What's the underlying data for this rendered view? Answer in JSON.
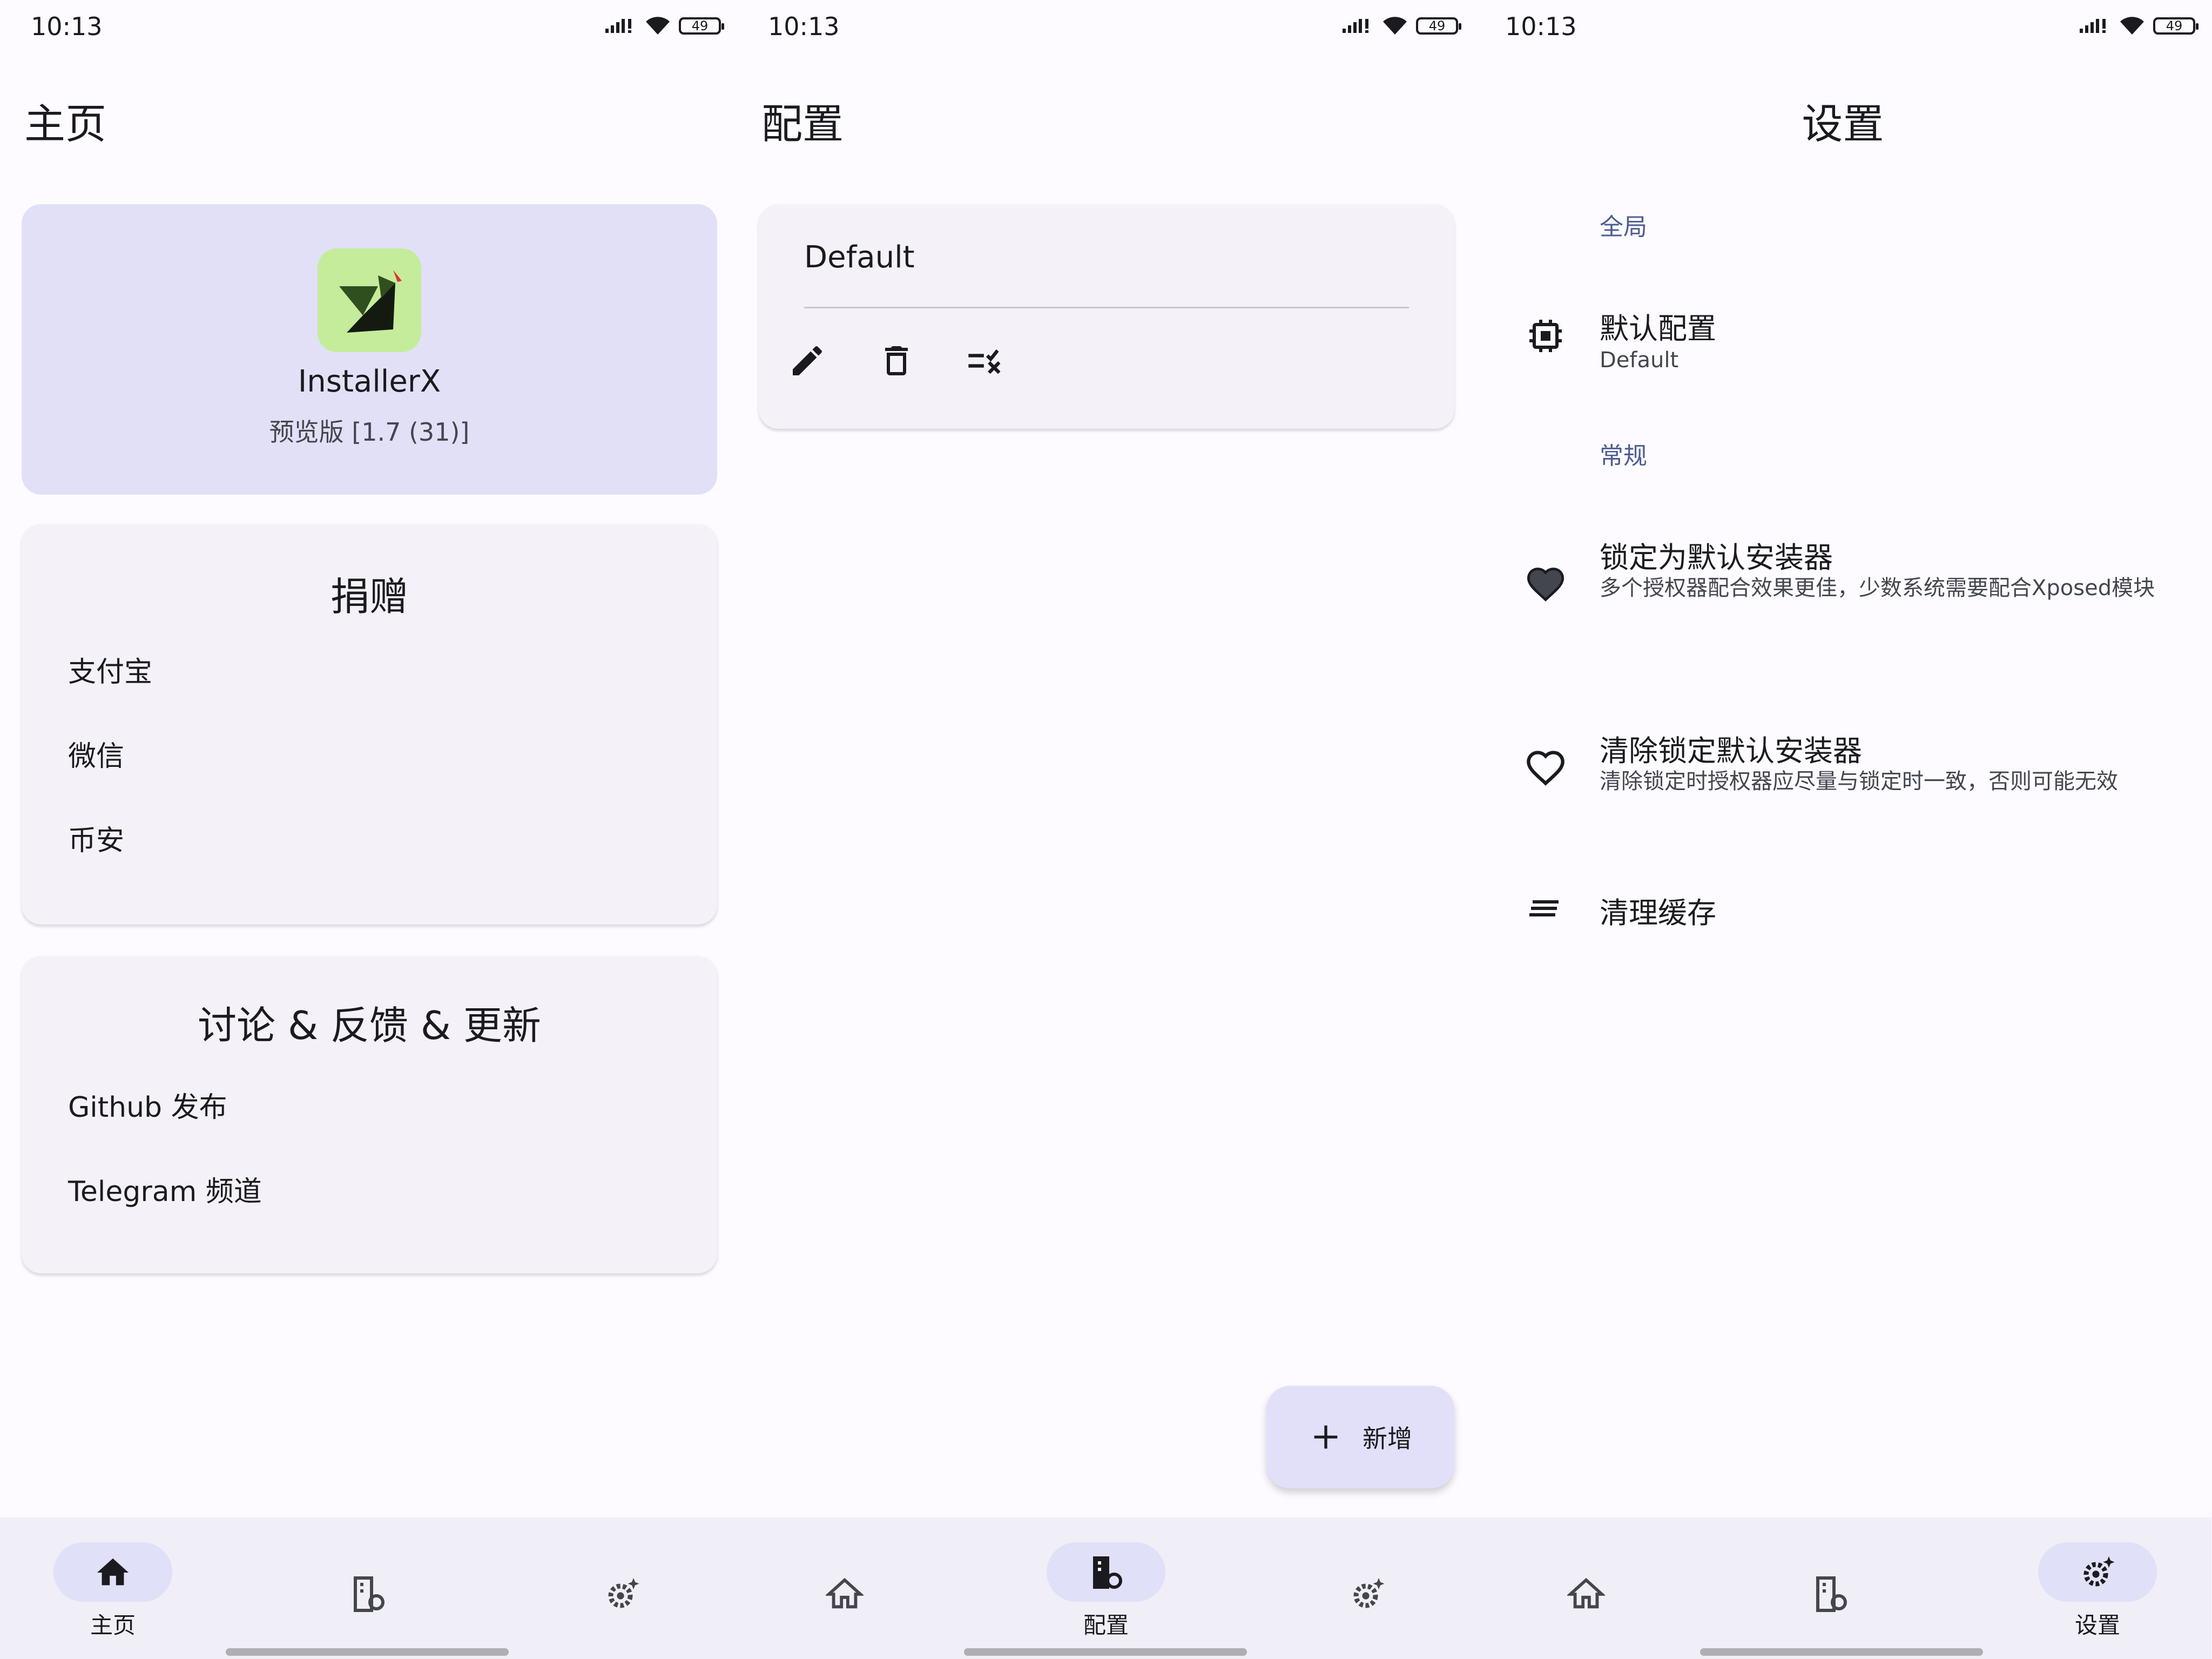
{
  "status_bar": {
    "time": "10:13",
    "battery": "49"
  },
  "home": {
    "title": "主页",
    "app": {
      "name": "InstallerX",
      "version": "预览版 [1.7 (31)]"
    },
    "donate": {
      "title": "捐赠",
      "items": [
        "支付宝",
        "微信",
        "币安"
      ]
    },
    "discuss": {
      "title": "讨论 & 反馈 & 更新",
      "items": [
        "Github 发布",
        "Telegram 频道"
      ]
    }
  },
  "config": {
    "title": "配置",
    "profile_name": "Default",
    "fab_label": "新增"
  },
  "settings": {
    "title": "设置",
    "section_global": "全局",
    "default_config": {
      "title": "默认配置",
      "subtitle": "Default"
    },
    "section_general": "常规",
    "lock_installer": {
      "title": "锁定为默认安装器",
      "subtitle": "多个授权器配合效果更佳，少数系统需要配合Xposed模块"
    },
    "unlock_installer": {
      "title": "清除锁定默认安装器",
      "subtitle": "清除锁定时授权器应尽量与锁定时一致，否则可能无效"
    },
    "clear_cache": {
      "title": "清理缓存"
    }
  },
  "nav": {
    "home": "主页",
    "config": "配置",
    "settings": "设置"
  },
  "colors": {
    "accent_container": "#e2e0f7",
    "section_label": "#4d5c92",
    "logo_bg": "#c5ec9b"
  }
}
